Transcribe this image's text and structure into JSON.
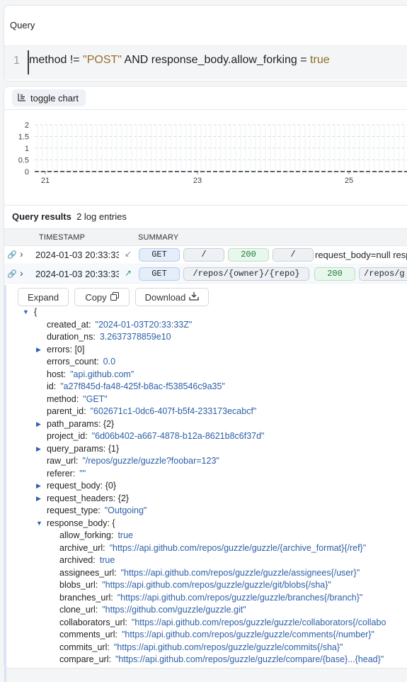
{
  "query": {
    "label": "Query",
    "line_number": "1",
    "text_parts": [
      "method != ",
      "\"POST\"",
      " AND  response_body.allow_forking = ",
      "true"
    ]
  },
  "chart": {
    "toggle_label": "toggle chart",
    "chart_data": {
      "type": "line",
      "x_ticks": [
        "21",
        "23",
        "25"
      ],
      "y_ticks": [
        "2",
        "1.5",
        "1",
        "0.5",
        "0"
      ],
      "ylim": [
        0,
        2
      ],
      "series": [
        {
          "values": [
            0,
            0,
            0,
            0,
            0
          ]
        }
      ],
      "grid": true
    }
  },
  "results": {
    "title": "Query results",
    "count_label": "2  log entries",
    "columns": [
      "TIMESTAMP",
      "SUMMARY"
    ],
    "rows": [
      {
        "timestamp": "2024-01-03 20:33:33",
        "direction": "↙",
        "method": "GET",
        "path": "/",
        "status": "200",
        "raw_path": "/",
        "rest": "request_body=null resp"
      },
      {
        "timestamp": "2024-01-03 20:33:33",
        "direction": "↗",
        "method": "GET",
        "path": "/repos/{owner}/{repo}",
        "status": "200",
        "raw_path": "/repos/g",
        "rest": ""
      }
    ]
  },
  "detail": {
    "expand_label": "Expand",
    "copy_label": "Copy",
    "download_label": "Download",
    "lines": [
      {
        "k": "{",
        "v": "",
        "indent": 0,
        "tri": "▼"
      },
      {
        "k": "created_at:",
        "v": "\"2024-01-03T20:33:33Z\"",
        "indent": 1
      },
      {
        "k": "duration_ns:",
        "v": "3.2637378859e10",
        "indent": 1
      },
      {
        "k": "errors: [0]",
        "v": "",
        "indent": 1,
        "tri": "▶"
      },
      {
        "k": "errors_count:",
        "v": "0.0",
        "indent": 1
      },
      {
        "k": "host:",
        "v": "\"api.github.com\"",
        "indent": 1
      },
      {
        "k": "id:",
        "v": "\"a27f845d-fa48-425f-b8ac-f538546c9a35\"",
        "indent": 1
      },
      {
        "k": "method:",
        "v": "\"GET\"",
        "indent": 1
      },
      {
        "k": "parent_id:",
        "v": "\"602671c1-0dc6-407f-b5f4-233173ecabcf\"",
        "indent": 1
      },
      {
        "k": "path_params: {2}",
        "v": "",
        "indent": 1,
        "tri": "▶"
      },
      {
        "k": "project_id:",
        "v": "\"6d06b402-a667-4878-b12a-8621b8c6f37d\"",
        "indent": 1
      },
      {
        "k": "query_params: {1}",
        "v": "",
        "indent": 1,
        "tri": "▶"
      },
      {
        "k": "raw_url:",
        "v": "\"/repos/guzzle/guzzle?foobar=123\"",
        "indent": 1
      },
      {
        "k": "referer:",
        "v": "\"\"",
        "indent": 1
      },
      {
        "k": "request_body: {0}",
        "v": "",
        "indent": 1,
        "tri": "▶"
      },
      {
        "k": "request_headers: {2}",
        "v": "",
        "indent": 1,
        "tri": "▶"
      },
      {
        "k": "request_type:",
        "v": "\"Outgoing\"",
        "indent": 1
      },
      {
        "k": "response_body: {",
        "v": "",
        "indent": 1,
        "tri": "▼"
      },
      {
        "k": "allow_forking:",
        "v": "true",
        "indent": 2
      },
      {
        "k": "archive_url:",
        "v": "\"https://api.github.com/repos/guzzle/guzzle/{archive_format}{/ref}\"",
        "indent": 2
      },
      {
        "k": "archived:",
        "v": "true",
        "indent": 2
      },
      {
        "k": "assignees_url:",
        "v": "\"https://api.github.com/repos/guzzle/guzzle/assignees{/user}\"",
        "indent": 2
      },
      {
        "k": "blobs_url:",
        "v": "\"https://api.github.com/repos/guzzle/guzzle/git/blobs{/sha}\"",
        "indent": 2
      },
      {
        "k": "branches_url:",
        "v": "\"https://api.github.com/repos/guzzle/guzzle/branches{/branch}\"",
        "indent": 2
      },
      {
        "k": "clone_url:",
        "v": "\"https://github.com/guzzle/guzzle.git\"",
        "indent": 2
      },
      {
        "k": "collaborators_url:",
        "v": "\"https://api.github.com/repos/guzzle/guzzle/collaborators{/collabo",
        "indent": 2
      },
      {
        "k": "comments_url:",
        "v": "\"https://api.github.com/repos/guzzle/guzzle/comments{/number}\"",
        "indent": 2
      },
      {
        "k": "commits_url:",
        "v": "\"https://api.github.com/repos/guzzle/guzzle/commits{/sha}\"",
        "indent": 2
      },
      {
        "k": "compare_url:",
        "v": "\"https://api.github.com/repos/guzzle/guzzle/compare/{base}...{head}\"",
        "indent": 2
      }
    ]
  }
}
